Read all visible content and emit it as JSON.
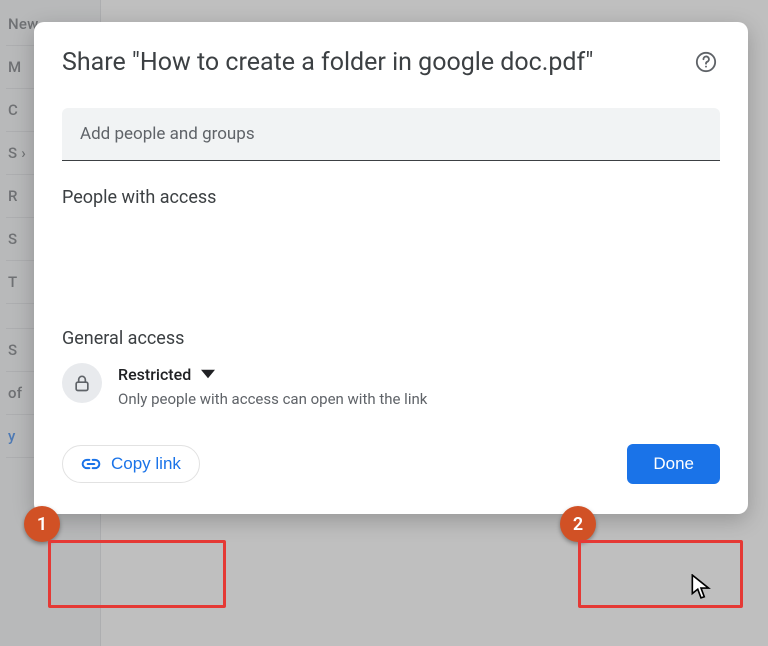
{
  "sidebar": {
    "items": [
      "New",
      "M",
      "C",
      "S ›",
      "R",
      "S",
      "T",
      "",
      "S",
      "of",
      "y"
    ]
  },
  "dialog": {
    "title": "Share \"How to create a folder in google doc.pdf\"",
    "addPlaceholder": "Add people and groups",
    "peopleHeading": "People with access",
    "generalHeading": "General access",
    "access": {
      "label": "Restricted",
      "description": "Only people with access can open with the link"
    },
    "copyLink": "Copy link",
    "done": "Done"
  },
  "annotations": {
    "marker1": "1",
    "marker2": "2"
  }
}
